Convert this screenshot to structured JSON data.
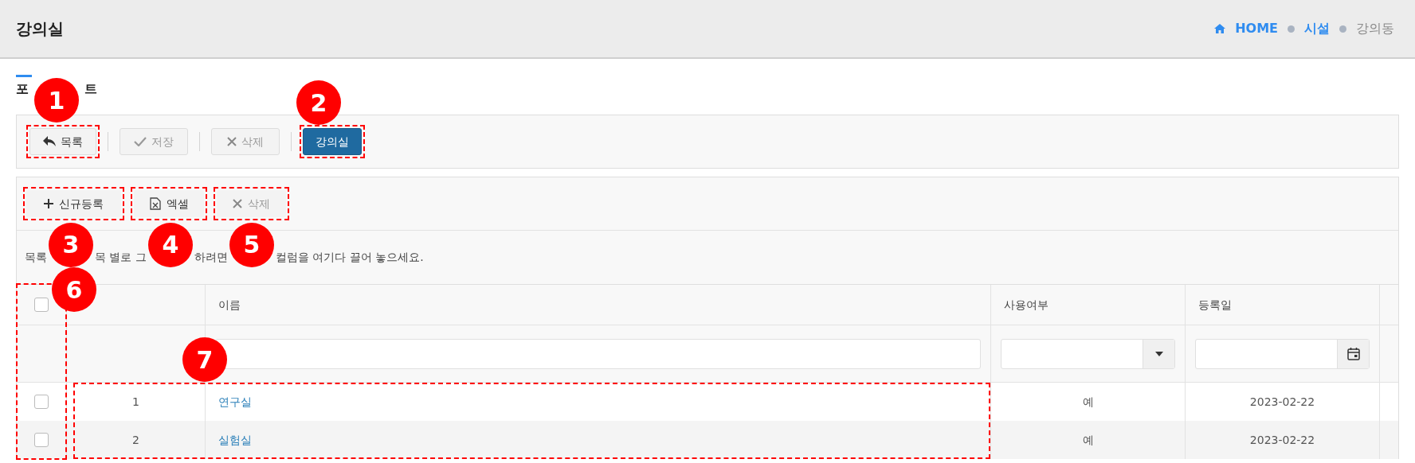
{
  "page_title": "강의실",
  "breadcrumb": [
    {
      "label": "HOME",
      "kind": "home",
      "current": false
    },
    {
      "label": "시설",
      "kind": "link",
      "current": false
    },
    {
      "label": "강의동",
      "kind": "link",
      "current": true
    }
  ],
  "section_title_parts": [
    "포",
    "트"
  ],
  "toolbar": [
    {
      "label": "목록",
      "kind": "back",
      "disabled": false,
      "framed": true
    },
    {
      "label": "저장",
      "kind": "save",
      "disabled": true,
      "framed": false
    },
    {
      "label": "삭제",
      "kind": "delete",
      "disabled": true,
      "framed": false
    },
    {
      "label": "강의실",
      "kind": "primary",
      "disabled": false,
      "framed": true
    }
  ],
  "grid_toolbar": [
    {
      "label": "신규등록",
      "kind": "add",
      "disabled": false,
      "framed": true
    },
    {
      "label": "엑셀",
      "kind": "excel",
      "disabled": false,
      "framed": true
    },
    {
      "label": "삭제",
      "kind": "delete",
      "disabled": true,
      "framed": true
    }
  ],
  "group_hint_parts": [
    "목록",
    "목 별로 그",
    "하려면",
    "컬럼을 여기다 끌어 놓으세요."
  ],
  "table": {
    "select_all_checked": false,
    "checkbox_column_framed": true,
    "rows_framed": true,
    "columns": [
      {
        "label": "이름"
      },
      {
        "label": "사용여부"
      },
      {
        "label": "등록일"
      }
    ],
    "rows": [
      {
        "checked": false,
        "no": "1",
        "name": "연구실",
        "in_use": "예",
        "registered": "2023-02-22"
      },
      {
        "checked": false,
        "no": "2",
        "name": "실험실",
        "in_use": "예",
        "registered": "2023-02-22"
      }
    ]
  },
  "callouts": [
    {
      "number": "1"
    },
    {
      "number": "2"
    },
    {
      "number": "3"
    },
    {
      "number": "4"
    },
    {
      "number": "5"
    },
    {
      "number": "6"
    },
    {
      "number": "7"
    }
  ]
}
